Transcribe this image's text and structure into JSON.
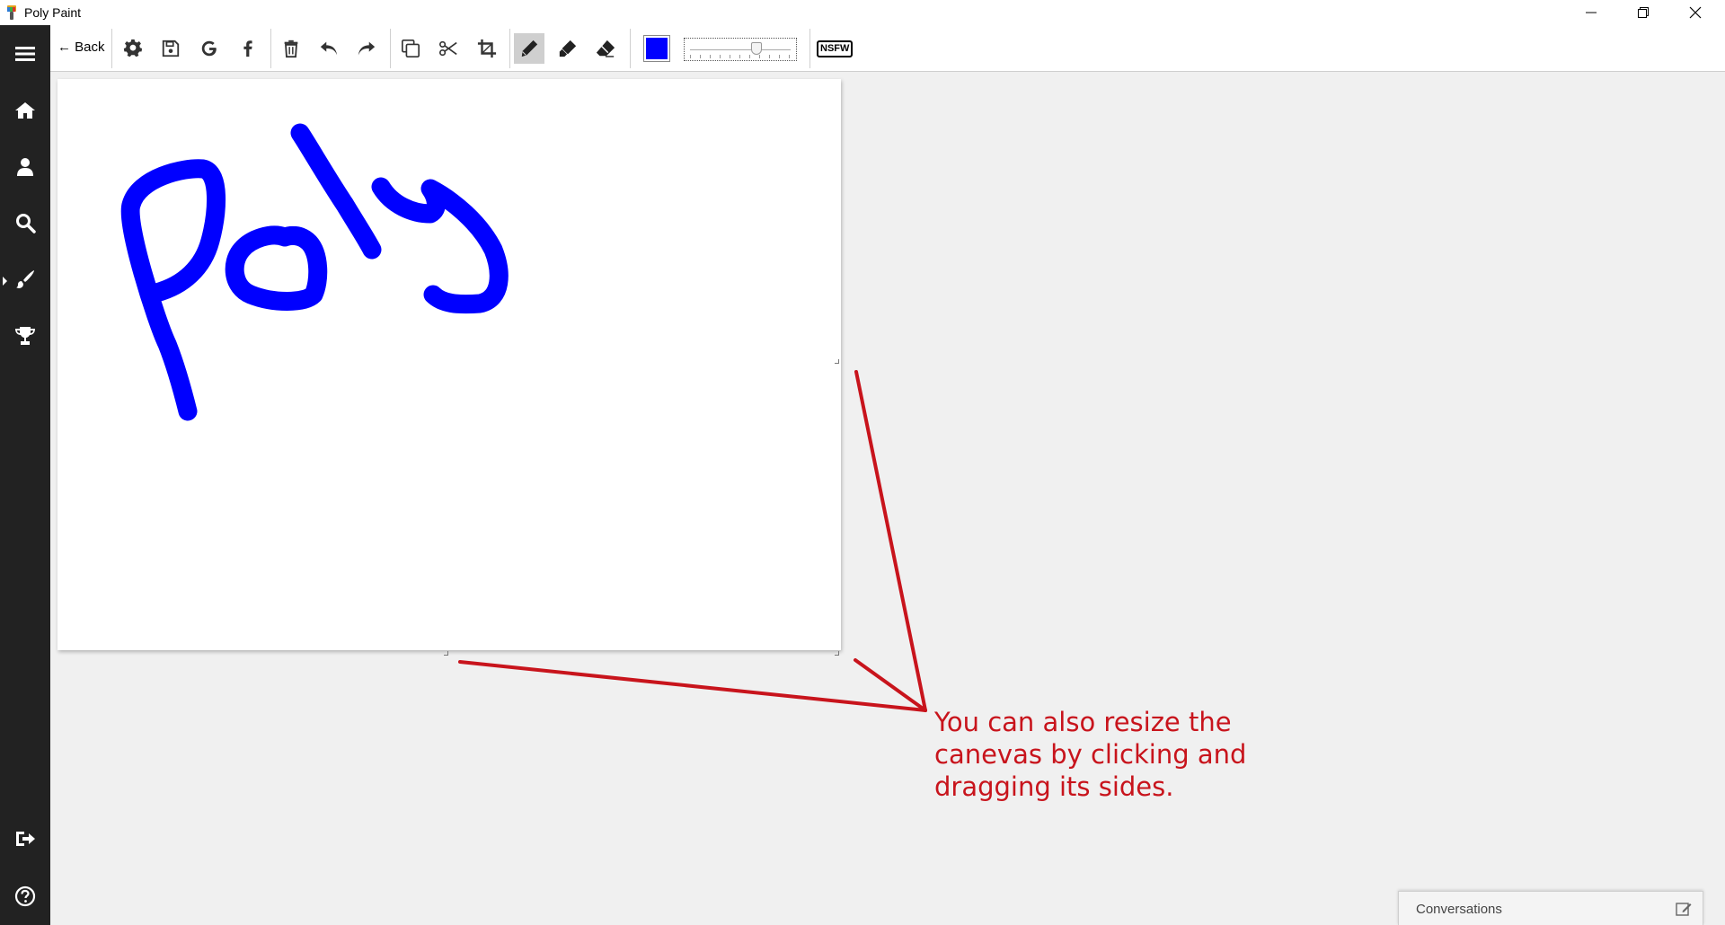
{
  "window": {
    "title": "Poly Paint",
    "controls": [
      "minimize",
      "restore",
      "close"
    ]
  },
  "sidebar": {
    "items": [
      {
        "name": "menu",
        "icon": "hamburger-icon"
      },
      {
        "name": "home",
        "icon": "home-icon"
      },
      {
        "name": "profile",
        "icon": "user-icon"
      },
      {
        "name": "search",
        "icon": "search-icon"
      },
      {
        "name": "paint",
        "icon": "brush-icon",
        "active": true
      },
      {
        "name": "achievements",
        "icon": "trophy-icon"
      },
      {
        "name": "logout",
        "icon": "sign-out-icon"
      },
      {
        "name": "help",
        "icon": "question-circle-icon"
      }
    ]
  },
  "toolbar": {
    "back_label": "← Back",
    "tools": [
      {
        "name": "settings",
        "icon": "gear-icon"
      },
      {
        "name": "save",
        "icon": "floppy-disk-icon"
      },
      {
        "name": "google-share",
        "icon": "google-icon"
      },
      {
        "name": "facebook-share",
        "icon": "facebook-icon"
      },
      {
        "name": "delete",
        "icon": "trash-icon"
      },
      {
        "name": "undo",
        "icon": "undo-icon"
      },
      {
        "name": "redo",
        "icon": "redo-icon"
      },
      {
        "name": "duplicate",
        "icon": "copy-icon"
      },
      {
        "name": "cut",
        "icon": "scissors-icon"
      },
      {
        "name": "crop",
        "icon": "crop-icon"
      },
      {
        "name": "pencil",
        "icon": "pencil-icon",
        "selected": true
      },
      {
        "name": "marker",
        "icon": "marker-icon"
      },
      {
        "name": "eraser",
        "icon": "eraser-icon"
      }
    ],
    "current_color": "#0000ff",
    "stroke_size_fraction": 0.67,
    "nsfw_label": "NSFW"
  },
  "canvas": {
    "background": "#ffffff",
    "stroke_color": "#0000ff",
    "handwritten_text": "Poly"
  },
  "annotation": {
    "text": "You can also resize the canevas by clicking and dragging its sides.",
    "color": "#c8141c"
  },
  "conversations": {
    "label": "Conversations",
    "icon": "edit-icon"
  }
}
